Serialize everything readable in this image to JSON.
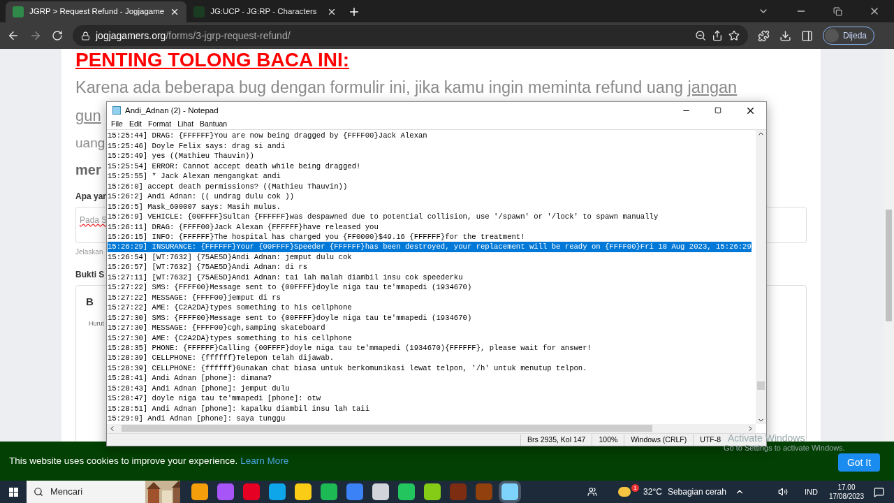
{
  "browser": {
    "tabs": [
      {
        "title": "JGRP > Request Refund - Jogjagame",
        "selected": true
      },
      {
        "title": "JG:UCP - JG:RP - Characters",
        "selected": false
      }
    ],
    "url_host": "jogjagamers.org",
    "url_path": "/forms/3-jgrp-request-refund/",
    "profile": "Dijeda"
  },
  "page": {
    "heading": "PENTING TOLONG BACA INI:",
    "paragraph": "Karena ada beberapa bug dengan formulir ini, jika kamu ingin meminta refund uang",
    "paragraph_link": "jangan",
    "line_2": "gun",
    "line_3": "uang",
    "line_4": "mer",
    "question_label": "Apa yar",
    "answer_text": "Pada S",
    "hint": "Jelaskan",
    "proof_label": "Bukti S",
    "bold_tool": "B",
    "editor_text": "Hurut"
  },
  "notepad": {
    "title": "Andi_Adnan (2) - Notepad",
    "menu": [
      "File",
      "Edit",
      "Format",
      "Lihat",
      "Bantuan"
    ],
    "lines": [
      {
        "text": "15:25:44] DRAG: {FFFFFF}You are now being dragged by {FFFF00}Jack Alexan",
        "selected": false
      },
      {
        "text": "15:25:46] Doyle Felix says: drag si andi",
        "selected": false
      },
      {
        "text": "15:25:49] yes ((Mathieu Thauvin))",
        "selected": false
      },
      {
        "text": "15:25:54] ERROR: Cannot accept death while being dragged!",
        "selected": false
      },
      {
        "text": "15:25:55] * Jack Alexan mengangkat andi",
        "selected": false
      },
      {
        "text": "15:26:0] accept death permissions? ((Mathieu Thauvin))",
        "selected": false
      },
      {
        "text": "15:26:2] Andi Adnan: (( undrag dulu cok ))",
        "selected": false
      },
      {
        "text": "15:26:5] Mask_600007 says: Masih mulus.",
        "selected": false
      },
      {
        "text": "15:26:9] VEHICLE: {00FFFF}Sultan {FFFFFF}was despawned due to potential collision, use '/spawn' or '/lock' to spawn manually",
        "selected": false
      },
      {
        "text": "15:26:11] DRAG: {FFFF00}Jack Alexan {FFFFFF}have released you",
        "selected": false
      },
      {
        "text": "15:26:15] INFO: {FFFFFF}The hospital has charged you {FF0000}$49.16 {FFFFFF}for the treatment!",
        "selected": false
      },
      {
        "text": "15:26:29] INSURANCE: {FFFFFF}Your {00FFFF}Speeder {FFFFFF}has been destroyed, your replacement will be ready on {FFFF00}Fri 18 Aug 2023, 15:26:29",
        "selected": true
      },
      {
        "text": "15:26:54] [WT:7632] {75AE5D}Andi Adnan: jemput dulu cok",
        "selected": false
      },
      {
        "text": "15:26:57] [WT:7632] {75AE5D}Andi Adnan: di rs",
        "selected": false
      },
      {
        "text": "15:27:11] [WT:7632] {75AE5D}Andi Adnan: tai lah malah diambil insu cok speederku",
        "selected": false
      },
      {
        "text": "15:27:22] SMS: {FFFF00}Message sent to {00FFFF}doyle niga tau te'mmapedi (1934670)",
        "selected": false
      },
      {
        "text": "15:27:22] MESSAGE: {FFFF00}jemput di rs",
        "selected": false
      },
      {
        "text": "15:27:22] AME: {C2A2DA}types something to his cellphone",
        "selected": false
      },
      {
        "text": "15:27:30] SMS: {FFFF00}Message sent to {00FFFF}doyle niga tau te'mmapedi (1934670)",
        "selected": false
      },
      {
        "text": "15:27:30] MESSAGE: {FFFF00}cgh,samping skateboard",
        "selected": false
      },
      {
        "text": "15:27:30] AME: {C2A2DA}types something to his cellphone",
        "selected": false
      },
      {
        "text": "15:28:35] PHONE: {FFFFFF}Calling {00FFFF}doyle niga tau te'mmapedi (1934670){FFFFFF}, please wait for answer!",
        "selected": false
      },
      {
        "text": "15:28:39] CELLPHONE: {ffffff}Telepon telah dijawab.",
        "selected": false
      },
      {
        "text": "15:28:39] CELLPHONE: {ffffff}Gunakan chat biasa untuk berkomunikasi lewat telpon, '/h' untuk menutup telpon.",
        "selected": false
      },
      {
        "text": "15:28:41] Andi Adnan [phone]: dimana?",
        "selected": false
      },
      {
        "text": "15:28:43] Andi Adnan [phone]: jemput dulu",
        "selected": false
      },
      {
        "text": "15:28:47] doyle niga tau te'mmapedi [phone]: otw",
        "selected": false
      },
      {
        "text": "15:28:51] Andi Adnan [phone]: kapalku diambil insu lah taii",
        "selected": false
      },
      {
        "text": "15:29:9] Andi Adnan [phone]: saya tunggu",
        "selected": false
      }
    ],
    "status": [
      "Brs 2935, Kol 147",
      "100%",
      "Windows (CRLF)",
      "UTF-8"
    ]
  },
  "cookie": {
    "message": "This website uses cookies to improve your experience.",
    "link": "Learn More",
    "button": "Got It"
  },
  "activation": {
    "title": "Activate Windows",
    "subtitle": "Go to Settings to activate Windows."
  },
  "taskbar": {
    "search": "Mencari",
    "weather": "32°C",
    "weather_text": "Sebagian cerah",
    "weather_badge": "1",
    "language": "IND",
    "time": "17.00",
    "date": "17/08/2023"
  }
}
